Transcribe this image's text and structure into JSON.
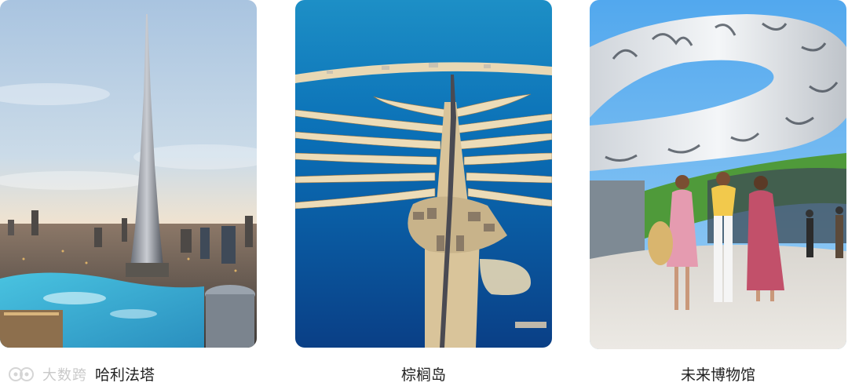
{
  "gallery": {
    "items": [
      {
        "label": "哈利法塔"
      },
      {
        "label": "棕榈岛"
      },
      {
        "label": "未来博物馆"
      }
    ]
  },
  "watermark": {
    "text": "大数跨"
  },
  "colors": {
    "caption_text": "#222222",
    "sky_blue": "#b9d4ec",
    "sea_blue": "#0e6fb8",
    "sand": "#e8d8b4"
  }
}
